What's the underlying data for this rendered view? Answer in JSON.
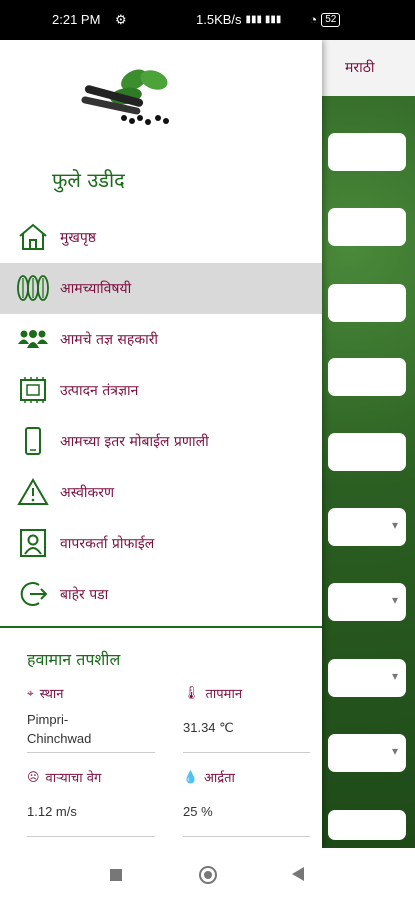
{
  "status_bar": {
    "time": "2:21 PM",
    "speed": "1.5KB/s",
    "battery": "52"
  },
  "app": {
    "language_label": "मराठी"
  },
  "drawer": {
    "title": "फुले उडीद",
    "menu": [
      {
        "label": "मुखपृष्ठ",
        "icon": "home-icon"
      },
      {
        "label": "आमच्याविषयी",
        "icon": "leaves-icon",
        "selected": true
      },
      {
        "label": "आमचे तज्ञ सहकारी",
        "icon": "team-icon"
      },
      {
        "label": "उत्पादन तंत्रज्ञान",
        "icon": "chip-icon"
      },
      {
        "label": "आमच्या इतर मोबाईल प्रणाली",
        "icon": "phone-icon"
      },
      {
        "label": "अस्वीकरण",
        "icon": "warning-icon"
      },
      {
        "label": "वापरकर्ता प्रोफाईल",
        "icon": "profile-icon"
      },
      {
        "label": "बाहेर पडा",
        "icon": "logout-icon"
      }
    ]
  },
  "weather": {
    "title": "हवामान तपशील",
    "location": {
      "label": "स्थान",
      "value": "Pimpri-\nChinchwad"
    },
    "temperature": {
      "label": "तापमान",
      "value": "31.34 ℃"
    },
    "wind_speed": {
      "label": "वाऱ्याचा वेग",
      "value": "1.12 m/s"
    },
    "humidity": {
      "label": "आर्द्रता",
      "value": "25 %"
    }
  },
  "colors": {
    "accent_green": "#1a6b1a",
    "label_maroon": "#7a1040",
    "selected_bg": "#d9d9d9"
  }
}
